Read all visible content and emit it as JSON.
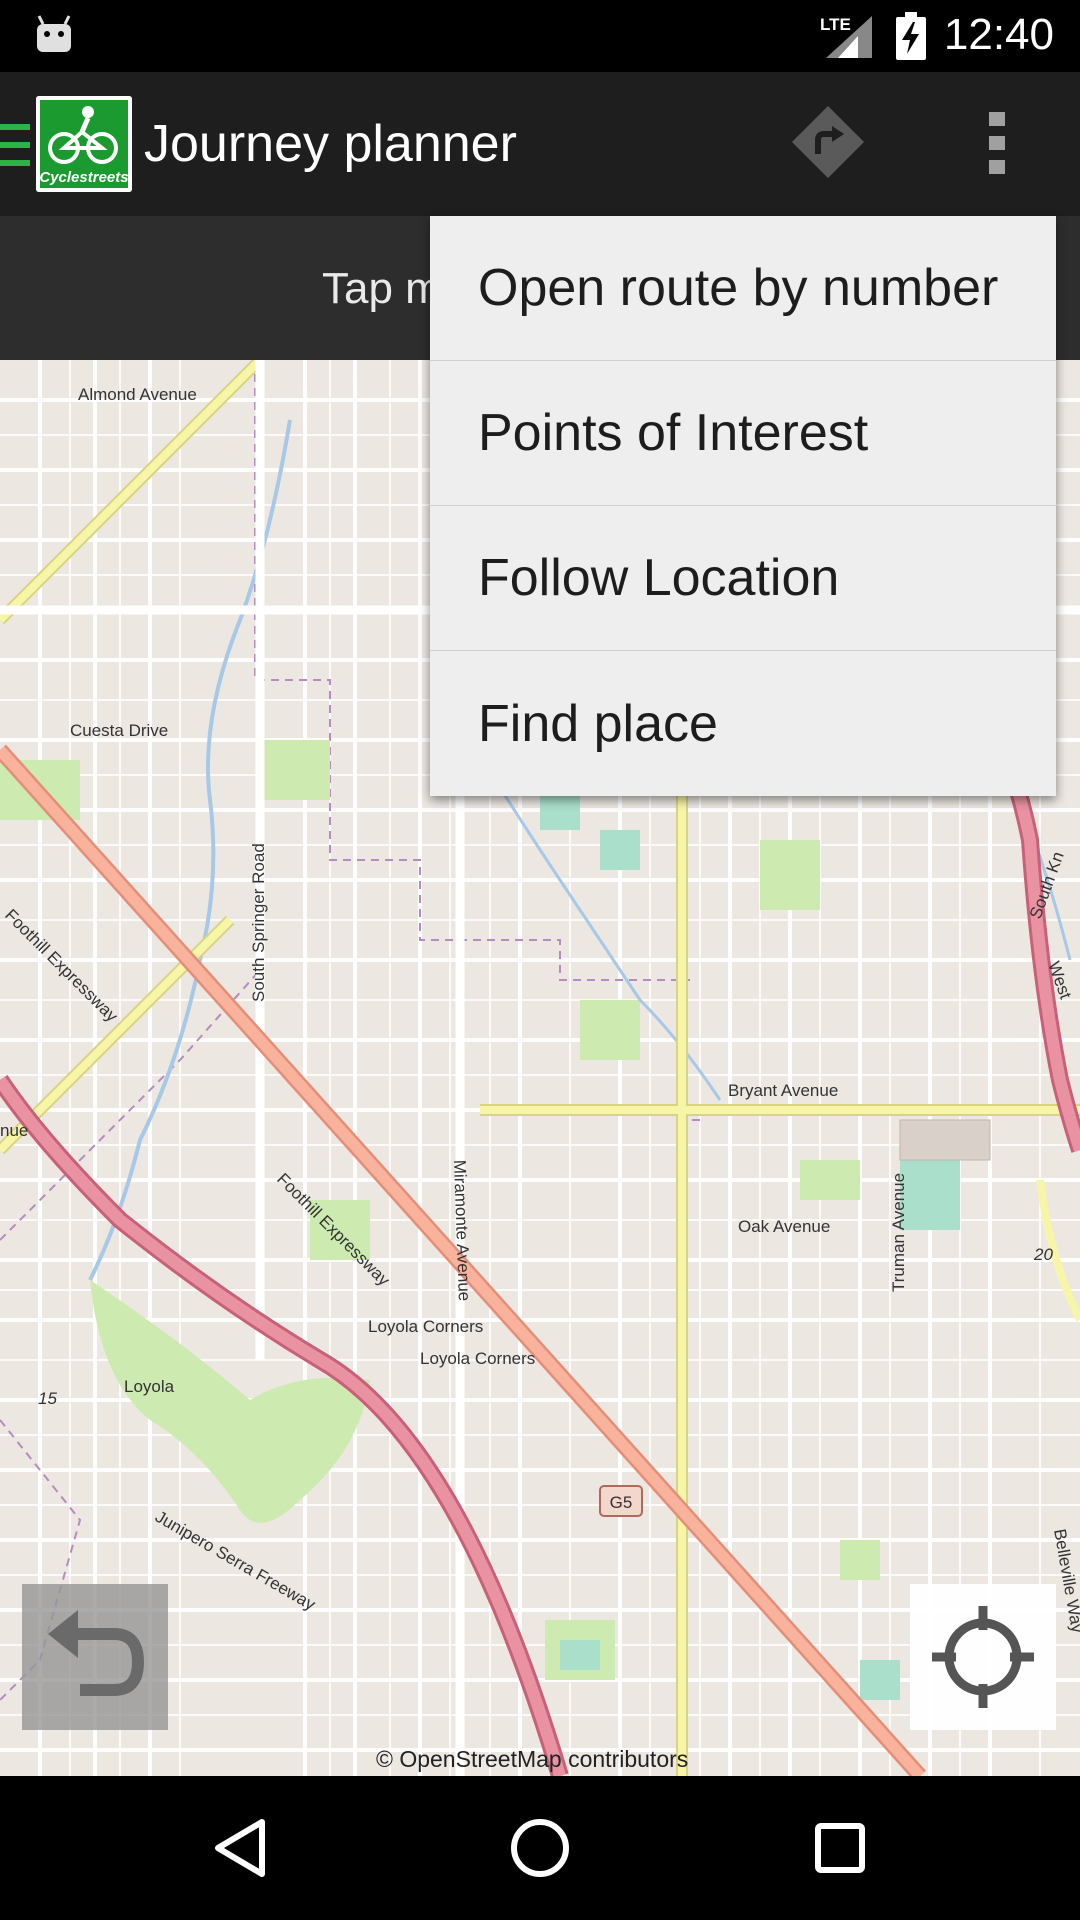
{
  "status_bar": {
    "time": "12:40",
    "network": "LTE",
    "icons": [
      "android-icon",
      "lte-signal-icon",
      "battery-charging-icon"
    ]
  },
  "action_bar": {
    "title": "Journey planner",
    "logo_text": "Cyclestreets",
    "icons": [
      "drawer-icon",
      "route-directions-icon",
      "overflow-menu-icon"
    ]
  },
  "hint": {
    "text": "Tap m"
  },
  "overflow_menu": {
    "items": [
      {
        "label": "Open route by number"
      },
      {
        "label": "Points of Interest"
      },
      {
        "label": "Follow Location"
      },
      {
        "label": "Find place"
      }
    ]
  },
  "map": {
    "labels": {
      "almond": "Almond Avenue",
      "cuesta": "Cuesta Drive",
      "springer": "South Springer Road",
      "foothill1": "Foothill Expressway",
      "foothill2": "Foothill Expressway",
      "miramonte": "Miramonte Avenue",
      "bryant": "Bryant Avenue",
      "oak": "Oak Avenue",
      "truman": "Truman Avenue",
      "loyola_corners_big": "Loyola Corners",
      "loyola_corners": "Loyola Corners",
      "loyola": "Loyola",
      "junipero": "Junipero Serra Freeway",
      "belleville": "Belleville Way",
      "west": "West",
      "south_kn": "South Kn",
      "nue": "nue",
      "shield_15": "15",
      "shield_20": "20",
      "shield_g5": "G5"
    },
    "attribution": "© OpenStreetMap contributors",
    "colors": {
      "background": "#ece7e1",
      "highway": "#e892a2",
      "major_road": "#f7f6a8",
      "trunk": "#f9b29c",
      "park": "#cdebb0",
      "pitch": "#aae0cb"
    }
  },
  "controls": {
    "back_icon": "undo-arrow-icon",
    "locate_icon": "crosshair-locate-icon"
  },
  "nav_bar": {
    "icons": [
      "nav-back-icon",
      "nav-home-icon",
      "nav-recents-icon"
    ]
  }
}
